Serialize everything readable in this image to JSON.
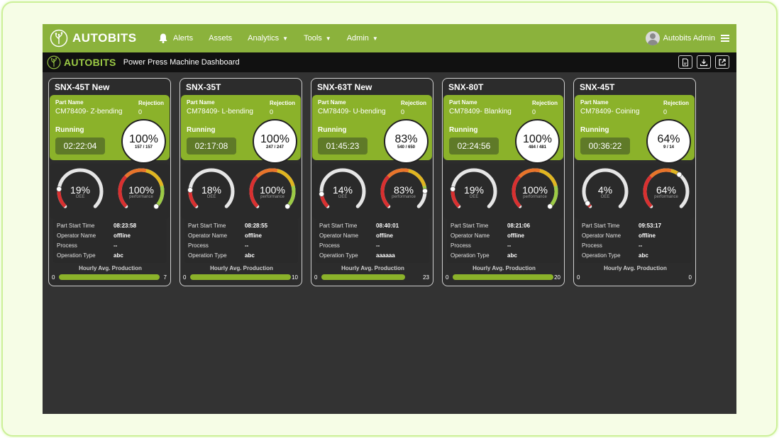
{
  "nav": {
    "brand": "AUTOBITS",
    "items": [
      {
        "label": "Alerts",
        "icon": "bell-icon",
        "caret": false
      },
      {
        "label": "Assets",
        "caret": false
      },
      {
        "label": "Analytics",
        "caret": true
      },
      {
        "label": "Tools",
        "caret": true
      },
      {
        "label": "Admin",
        "caret": true
      }
    ],
    "user": "Autobits Admin"
  },
  "subbar": {
    "brand": "AUTOBITS",
    "title": "Power Press Machine Dashboard",
    "tools": [
      "pdf-icon",
      "download-icon",
      "external-link-icon"
    ]
  },
  "labels": {
    "part_name": "Part Name",
    "rejection": "Rejection",
    "oee": "OEE",
    "performance": "performance",
    "part_start_time": "Part Start Time",
    "operator_name": "Operator Name",
    "process": "Process",
    "operation_type": "Operation Type",
    "hourly": "Hourly Avg. Production",
    "bar_min": "0"
  },
  "colors": {
    "accent": "#8bb22a",
    "nav": "#8bb23c",
    "gauge_red": "#d93030",
    "gauge_yellow": "#e0b520",
    "gauge_green": "#9ccb45",
    "gauge_track": "#e6e6e6"
  },
  "machines": [
    {
      "name": "SNX-45T New",
      "part": "CM78409- Z-bending",
      "rejection": "0",
      "status": "Running",
      "timer": "02:22:04",
      "count_pct": "100%",
      "count_frac": "157 / 157",
      "oee": "19%",
      "oee_value": 19,
      "performance": "100%",
      "performance_value": 100,
      "start_time": "08:23:58",
      "operator": "offline",
      "process": "--",
      "operation": "abc",
      "hourly_max": "7",
      "hourly_fill": 1.0
    },
    {
      "name": "SNX-35T",
      "part": "CM78409- L-bending",
      "rejection": "0",
      "status": "Running",
      "timer": "02:17:08",
      "count_pct": "100%",
      "count_frac": "247 / 247",
      "oee": "18%",
      "oee_value": 18,
      "performance": "100%",
      "performance_value": 100,
      "start_time": "08:28:55",
      "operator": "offline",
      "process": "--",
      "operation": "abc",
      "hourly_max": "10",
      "hourly_fill": 1.0
    },
    {
      "name": "SNX-63T New",
      "part": "CM78409- U-bending",
      "rejection": "0",
      "status": "Running",
      "timer": "01:45:23",
      "count_pct": "83%",
      "count_frac": "540 / 650",
      "oee": "14%",
      "oee_value": 14,
      "performance": "83%",
      "performance_value": 83,
      "start_time": "08:40:01",
      "operator": "offline",
      "process": "--",
      "operation": "aaaaaa",
      "hourly_max": "23",
      "hourly_fill": 0.83
    },
    {
      "name": "SNX-80T",
      "part": "CM78409- Blanking",
      "rejection": "0",
      "status": "Running",
      "timer": "02:24:56",
      "count_pct": "100%",
      "count_frac": "484 / 481",
      "oee": "19%",
      "oee_value": 19,
      "performance": "100%",
      "performance_value": 100,
      "start_time": "08:21:06",
      "operator": "offline",
      "process": "--",
      "operation": "abc",
      "hourly_max": "20",
      "hourly_fill": 1.0
    },
    {
      "name": "SNX-45T",
      "part": "CM78409- Coining",
      "rejection": "0",
      "status": "Running",
      "timer": "00:36:22",
      "count_pct": "64%",
      "count_frac": "9 / 14",
      "oee": "4%",
      "oee_value": 4,
      "performance": "64%",
      "performance_value": 64,
      "start_time": "09:53:17",
      "operator": "offline",
      "process": "--",
      "operation": "abc",
      "hourly_max": "0",
      "hourly_fill": 0
    }
  ]
}
